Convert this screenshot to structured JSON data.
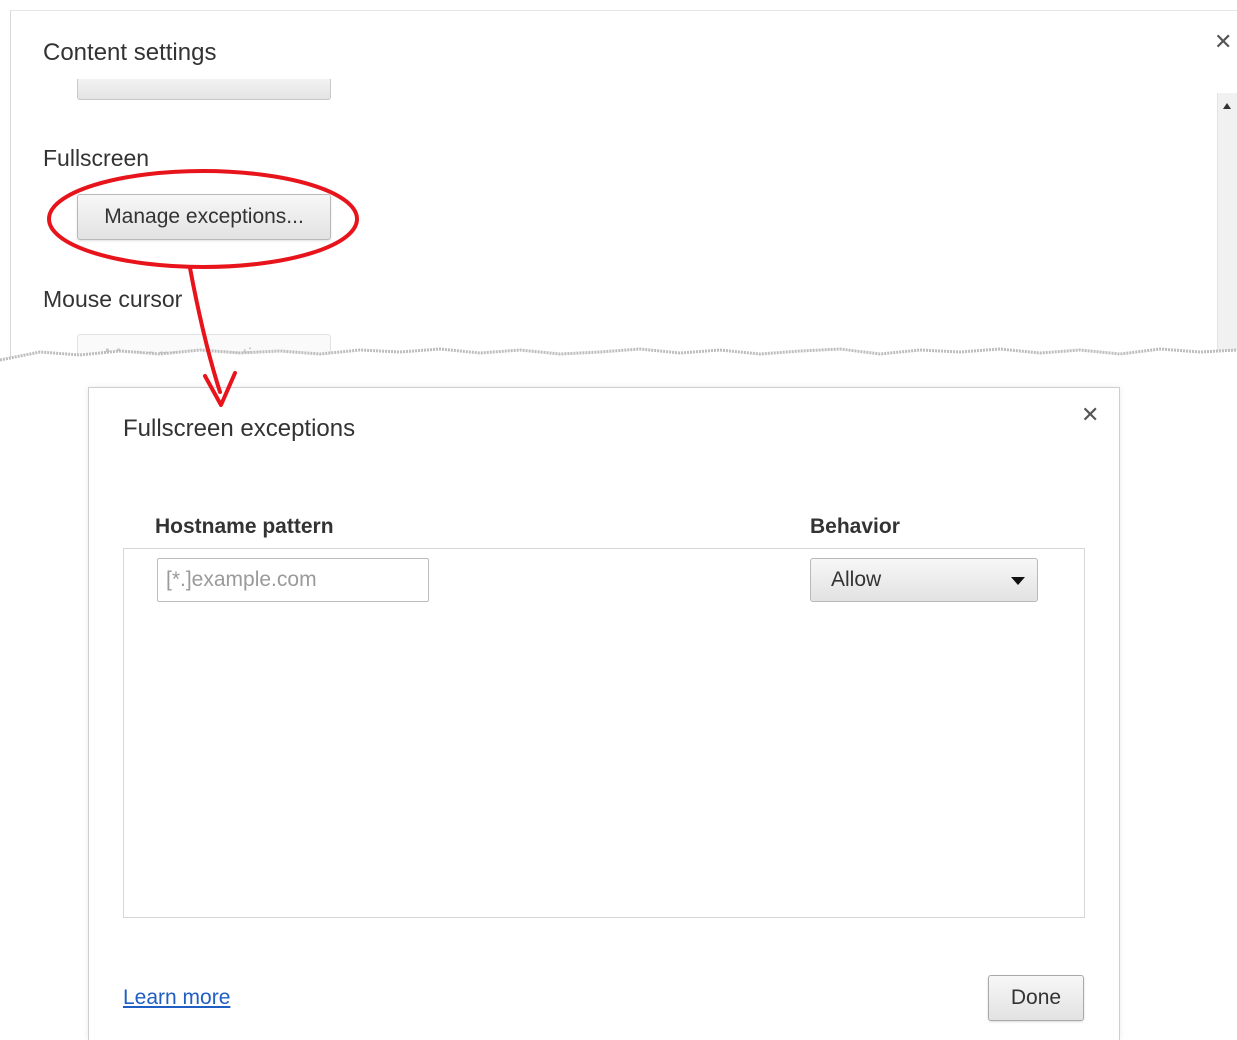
{
  "content_settings": {
    "title": "Content settings",
    "sections": {
      "fullscreen_label": "Fullscreen",
      "fullscreen_button": "Manage exceptions...",
      "mouse_cursor_label": "Mouse cursor",
      "mouse_cursor_button": "Manage exceptions..."
    }
  },
  "exceptions_dialog": {
    "title": "Fullscreen exceptions",
    "columns": {
      "hostname": "Hostname pattern",
      "behavior": "Behavior"
    },
    "hostname_input": {
      "value": "",
      "placeholder": "[*.]example.com"
    },
    "behavior_select": {
      "selected": "Allow"
    },
    "learn_more": "Learn more",
    "done_button": "Done"
  },
  "colors": {
    "annotation_red": "#e8141c",
    "link_blue": "#1f5fc4"
  },
  "icons": [
    "close-icon",
    "dropdown-caret-icon",
    "scroll-up-arrow-icon"
  ]
}
